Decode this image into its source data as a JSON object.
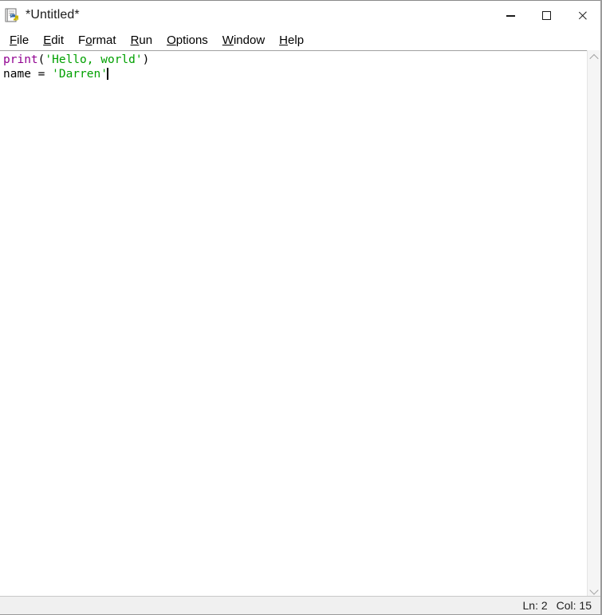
{
  "window": {
    "title": "*Untitled*",
    "icon": "idle-python-document-icon",
    "controls": [
      {
        "name": "minimize-button",
        "glyph": "minimize-icon",
        "label": "Minimize"
      },
      {
        "name": "maximize-button",
        "glyph": "maximize-icon",
        "label": "Maximize"
      },
      {
        "name": "close-button",
        "glyph": "close-icon",
        "label": "Close"
      }
    ]
  },
  "menubar": {
    "items": [
      {
        "label": "File",
        "pre": "",
        "accel": "F",
        "post": "ile"
      },
      {
        "label": "Edit",
        "pre": "",
        "accel": "E",
        "post": "dit"
      },
      {
        "label": "Format",
        "pre": "F",
        "accel": "o",
        "post": "rmat"
      },
      {
        "label": "Run",
        "pre": "",
        "accel": "R",
        "post": "un"
      },
      {
        "label": "Options",
        "pre": "",
        "accel": "O",
        "post": "ptions"
      },
      {
        "label": "Window",
        "pre": "",
        "accel": "W",
        "post": "indow"
      },
      {
        "label": "Help",
        "pre": "",
        "accel": "H",
        "post": "elp"
      }
    ]
  },
  "editor": {
    "lines": [
      {
        "number": 1,
        "text": "print('Hello, world')",
        "tokens": [
          {
            "text": "print",
            "type": "builtin"
          },
          {
            "text": "(",
            "type": "plain"
          },
          {
            "text": "'Hello, world'",
            "type": "string"
          },
          {
            "text": ")",
            "type": "plain"
          }
        ]
      },
      {
        "number": 2,
        "text": "name = 'Darren'",
        "tokens": [
          {
            "text": "name = ",
            "type": "plain"
          },
          {
            "text": "'Darren'",
            "type": "string"
          }
        ]
      }
    ],
    "caret_visible": true
  },
  "scrollbar": {
    "up_arrow": "chevron-up-icon",
    "down_arrow": "chevron-down-icon"
  },
  "statusbar": {
    "line_label": "Ln: 2",
    "col_label": "Col: 15"
  },
  "colors": {
    "builtin": "#900090",
    "string": "#00a000",
    "plain": "#000000",
    "statusbar_bg": "#f0f0f0",
    "scrollbar_bg": "#f5f5f5",
    "window_bg": "#ffffff"
  }
}
